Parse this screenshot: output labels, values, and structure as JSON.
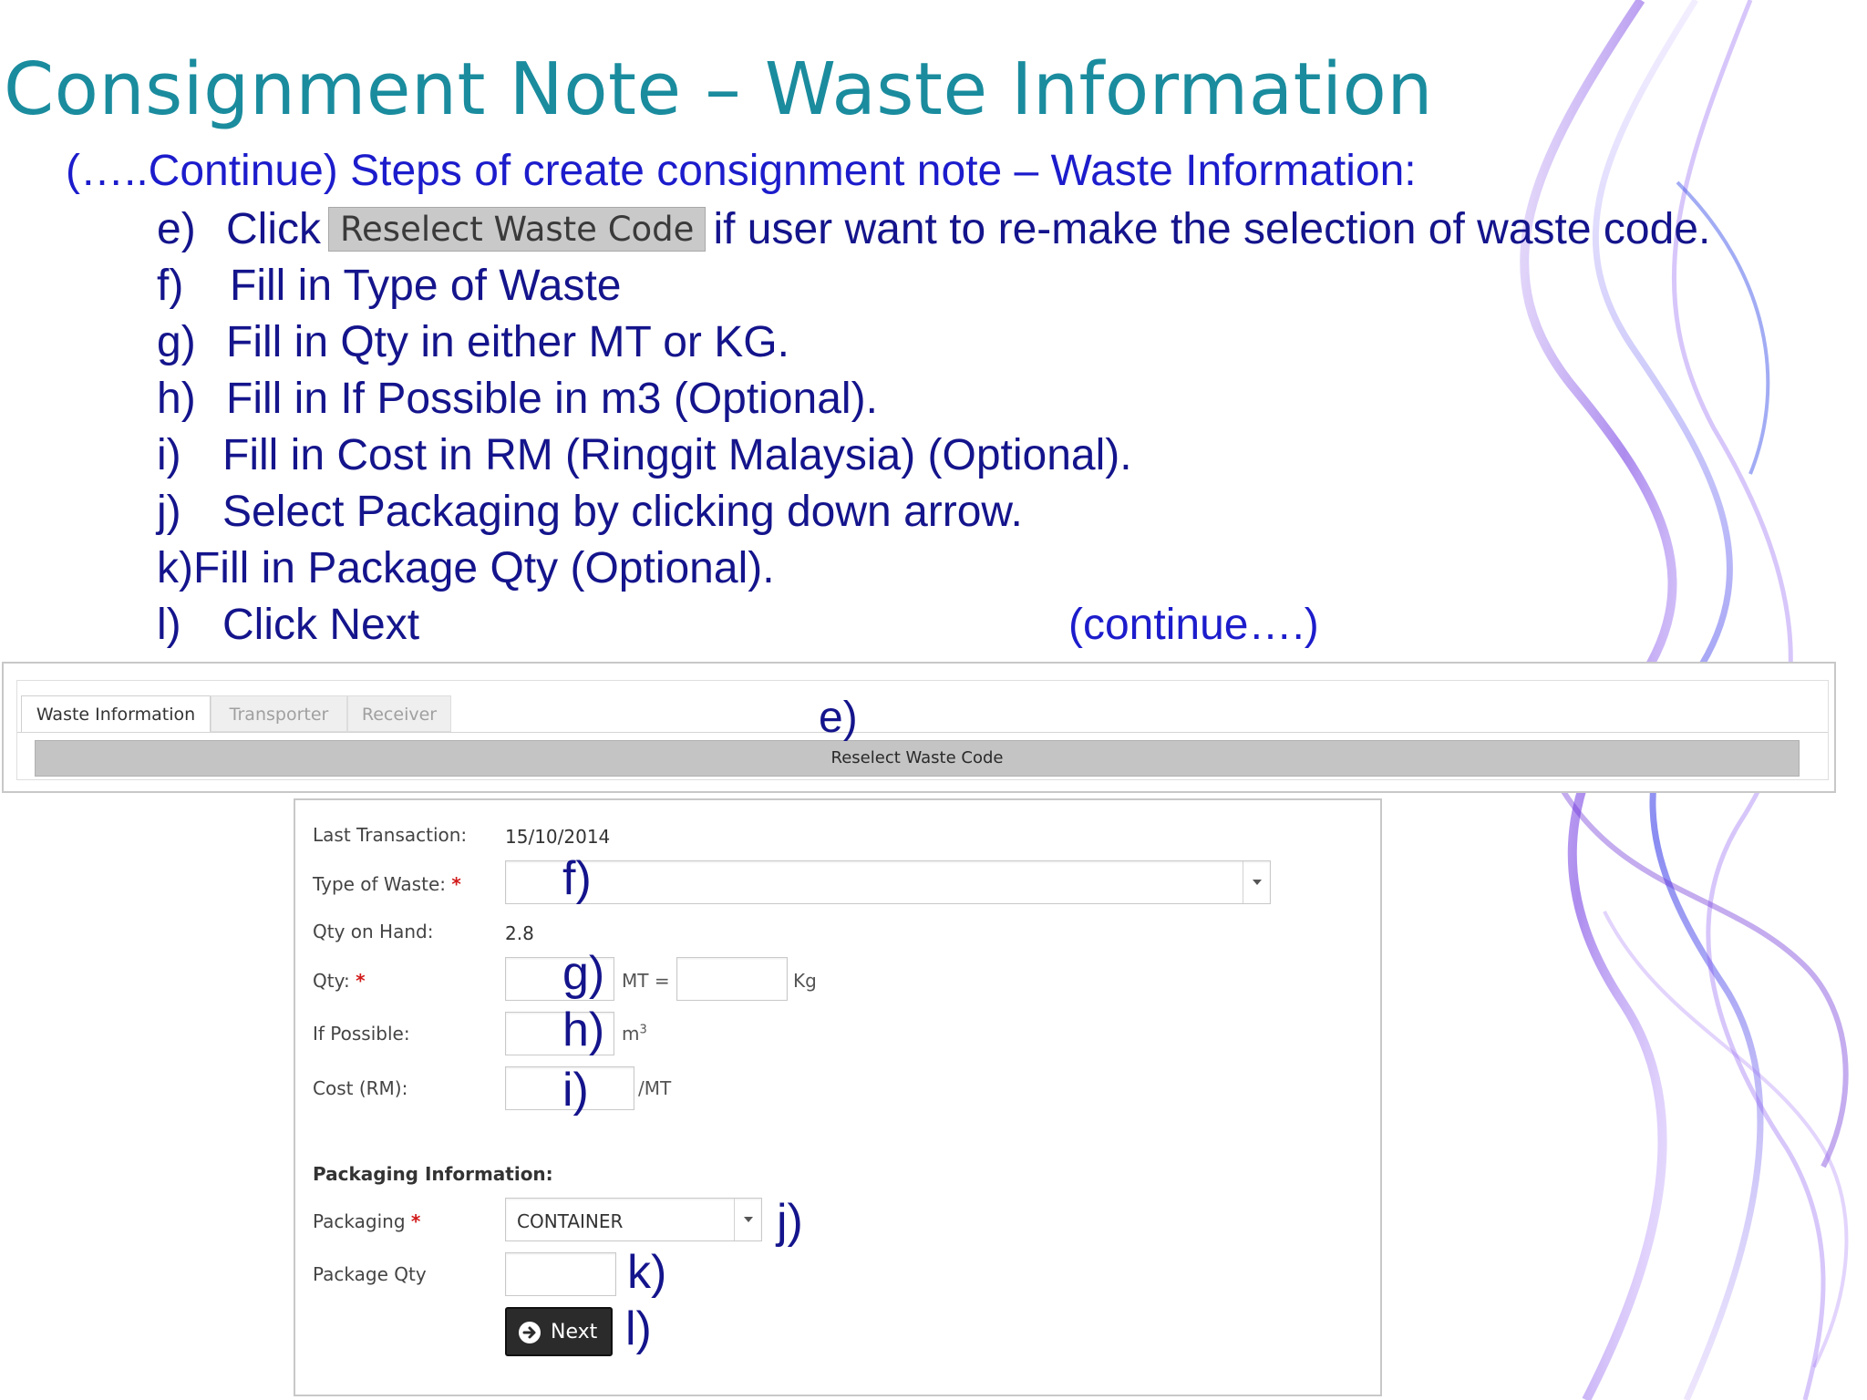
{
  "slide": {
    "title": "Consignment Note – Waste Information",
    "subtitle": "(…..Continue) Steps of create consignment note – Waste Information:",
    "steps": [
      {
        "marker": "e)",
        "before": "Click",
        "button": "Reselect Waste Code",
        "after": "if user want to re-make the selection of waste code."
      },
      {
        "marker": "f)",
        "text": "Fill in Type of Waste"
      },
      {
        "marker": "g)",
        "text": "Fill in Qty in either MT or KG."
      },
      {
        "marker": "h)",
        "text": "Fill in If Possible in m3 (Optional)."
      },
      {
        "marker": "i)",
        "text": "Fill in Cost in RM (Ringgit Malaysia) (Optional)."
      },
      {
        "marker": "j)",
        "text": "Select Packaging by clicking down arrow."
      },
      {
        "marker": "k)",
        "text": "Fill in Package Qty (Optional)."
      },
      {
        "marker": "l)",
        "text": "Click Next"
      }
    ],
    "continue_note": "(continue….)"
  },
  "tabs": [
    {
      "label": "Waste Information",
      "active": true
    },
    {
      "label": "Transporter",
      "active": false
    },
    {
      "label": "Receiver",
      "active": false
    }
  ],
  "reselect_button_label": "Reselect Waste Code",
  "form": {
    "last_transaction": {
      "label": "Last Transaction:",
      "value": "15/10/2014"
    },
    "type_of_waste": {
      "label": "Type of Waste:",
      "required_mark": "*",
      "value": ""
    },
    "qty_on_hand": {
      "label": "Qty on Hand:",
      "value": "2.8"
    },
    "qty": {
      "label": "Qty:",
      "required_mark": "*",
      "unit_mt": "MT =",
      "unit_kg": "Kg"
    },
    "if_possible": {
      "label": "If Possible:",
      "unit": "m",
      "unit_sup": "3"
    },
    "cost": {
      "label": "Cost (RM):",
      "unit": "/MT"
    },
    "packaging_section": "Packaging Information:",
    "packaging": {
      "label": "Packaging",
      "required_mark": "*",
      "value": "CONTAINER"
    },
    "package_qty": {
      "label": "Package Qty"
    },
    "next_label": "Next"
  },
  "annotations": {
    "e": "e)",
    "f": "f)",
    "g": "g)",
    "h": "h)",
    "i": "i)",
    "j": "j)",
    "k": "k)",
    "l": "l)"
  },
  "colors": {
    "title": "#1a8c9e",
    "subtitle": "#1c1ccc",
    "steps": "#14148c",
    "smoke": "#7b3fe0"
  }
}
